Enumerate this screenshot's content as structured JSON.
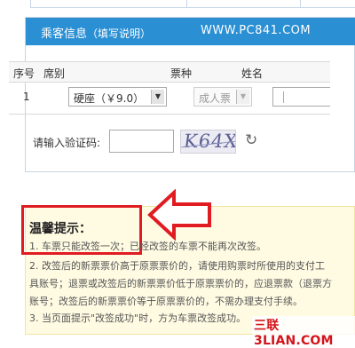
{
  "card": {
    "title": "乘客信息",
    "title_hint": "（填写说明）",
    "site_url": "WWW.PC841.COM"
  },
  "table": {
    "headers": [
      "序号",
      "席别",
      "票种",
      "姓名"
    ],
    "rows": [
      {
        "index": "1",
        "seat": "硬座（￥9.0）",
        "ticket_type": "成人票",
        "name": ""
      }
    ]
  },
  "verify": {
    "label": "请输入验证码:",
    "value": "",
    "captcha_text": "K64X",
    "refresh_icon": "refresh-icon"
  },
  "tips": {
    "title": "温馨提示：",
    "items": [
      "1. 车票只能改签一次；已经改签的车票不能再次改签。",
      "2. 改签后的新票票价高于原票票价的，请使用购票时所使用的支付工",
      "具账号；退票或改签后的新票票价低于原票票价的，应退票款（退票方",
      "账号；改签后的新票票价等于原票票价的，不需办理支付手续。",
      "3. 当页面提示\"改签成功\"时，方为车票改签成功。"
    ]
  },
  "watermark": "三联 3LIAN.COM",
  "colors": {
    "header_blue": "#2a8fd3",
    "highlight_red": "#e01c22",
    "tips_bg": "#fffbe3"
  }
}
